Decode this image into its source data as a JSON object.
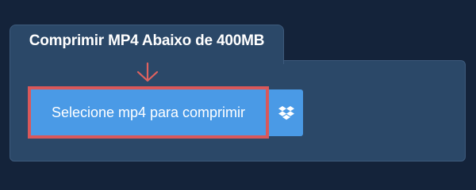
{
  "panel": {
    "title": "Comprimir MP4 Abaixo de 400MB"
  },
  "upload": {
    "select_label": "Selecione mp4 para comprimir",
    "dropbox_icon": "dropbox-icon",
    "pointer_icon": "arrow-down-icon"
  },
  "colors": {
    "background": "#14233a",
    "panel": "#2b4868",
    "button": "#4a9ae6",
    "highlight": "#d9585a"
  }
}
